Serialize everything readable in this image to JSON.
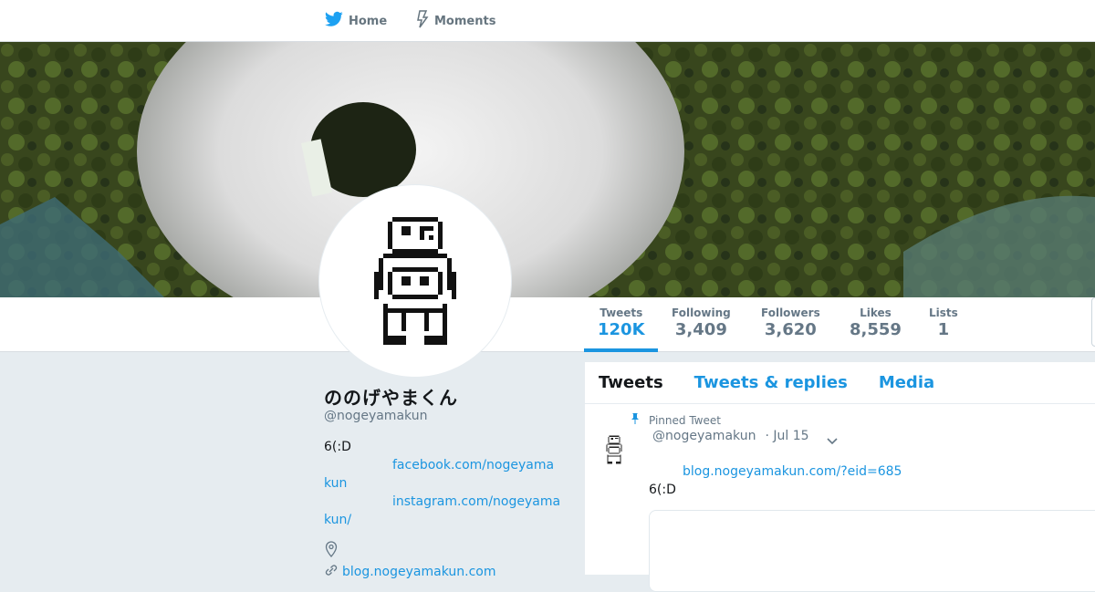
{
  "nav": {
    "home_label": "Home",
    "moments_label": "Moments"
  },
  "profile": {
    "name": "ののげやまくん",
    "handle": "@nogeyamakun",
    "bio_line1": "6(:D",
    "facebook_a": "facebook.com/nogeyama",
    "facebook_b": "kun",
    "instagram_a": "instagram.com/nogeyama",
    "instagram_b": "kun/",
    "website": "blog.nogeyamakun.com"
  },
  "stats": [
    {
      "label": "Tweets",
      "value": "120K"
    },
    {
      "label": "Following",
      "value": "3,409"
    },
    {
      "label": "Followers",
      "value": "3,620"
    },
    {
      "label": "Likes",
      "value": "8,559"
    },
    {
      "label": "Lists",
      "value": "1"
    }
  ],
  "timeline": {
    "tabs": [
      "Tweets",
      "Tweets & replies",
      "Media"
    ],
    "pinned_label": "Pinned Tweet",
    "tweet": {
      "handle": "@nogeyamakun",
      "date": "· Jul 15",
      "link": "blog.nogeyamakun.com/?eid=685",
      "text": "6(:D"
    }
  },
  "colors": {
    "accent": "#1b95e0",
    "page_bg": "#e6ecf0",
    "muted": "#657786"
  },
  "icons": {
    "bird": "twitter-bird-icon",
    "moments": "lightning-icon",
    "pin": "pin-icon",
    "location": "location-pin-icon",
    "link": "link-icon",
    "caret": "chevron-down-icon"
  }
}
